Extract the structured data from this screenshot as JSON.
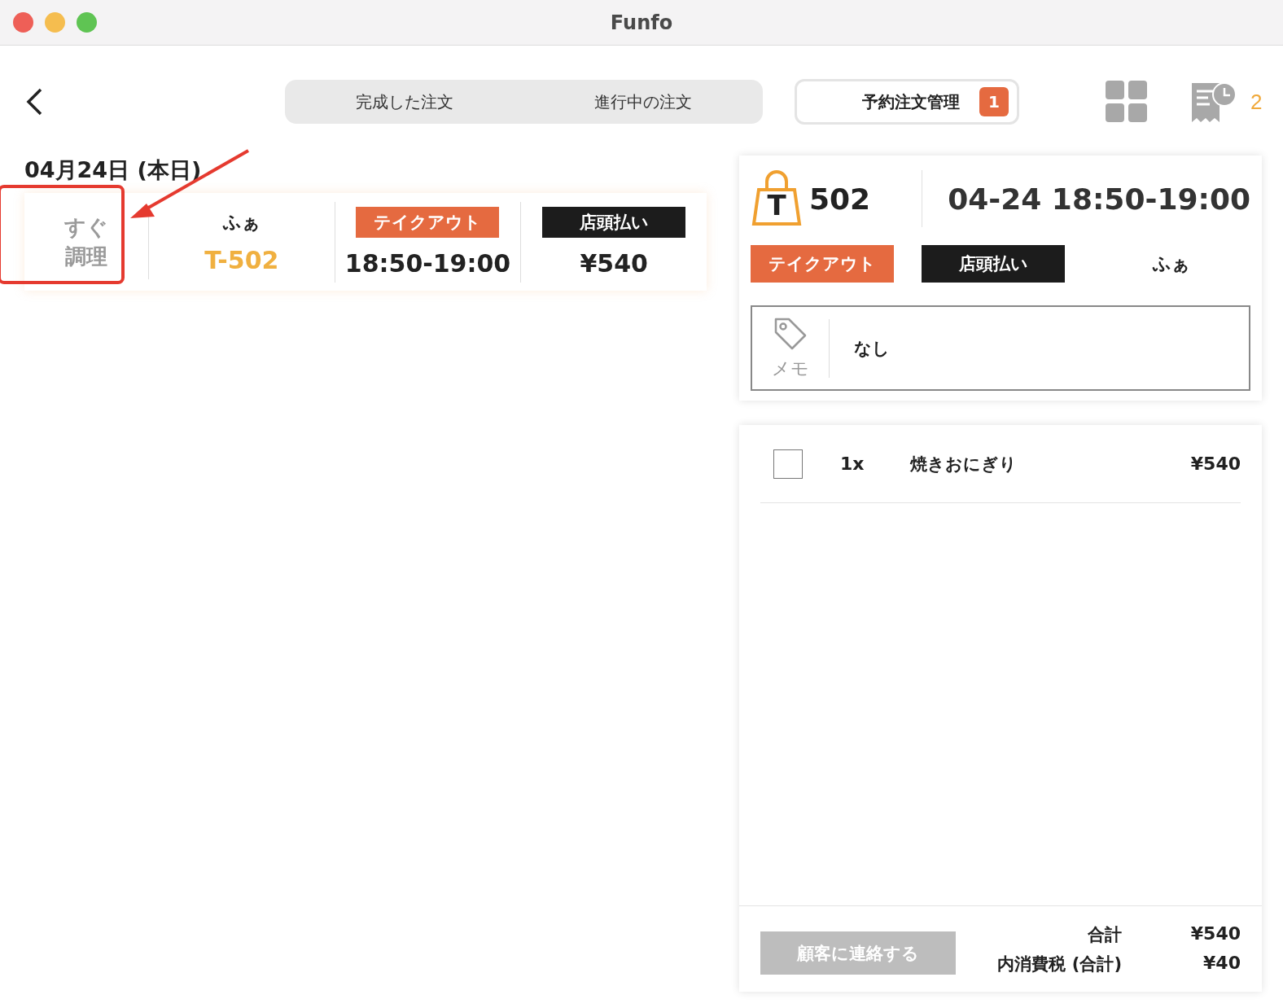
{
  "window": {
    "title": "Funfo"
  },
  "tabs": [
    {
      "label": "完成した注文",
      "selected": false
    },
    {
      "label": "進行中の注文",
      "selected": false
    }
  ],
  "reservation_button": {
    "label": "予約注文管理",
    "badge": "1",
    "selected": true
  },
  "pending_receipts": {
    "count": "2"
  },
  "date_heading": "04月24日 (本日)",
  "orders": [
    {
      "status": "すぐ調理",
      "customer": "ふぁ",
      "code": "T-502",
      "order_type": "テイクアウト",
      "time": "18:50-19:00",
      "payment": "店頭払い",
      "total": "¥540"
    }
  ],
  "detail": {
    "bag_letter": "T",
    "number": "502",
    "datetime": "04-24 18:50-19:00",
    "order_type": "テイクアウト",
    "payment": "店頭払い",
    "customer": "ふぁ",
    "memo_label": "メモ",
    "memo": "なし",
    "items": [
      {
        "checked": false,
        "qty": "1x",
        "name": "焼きおにぎり",
        "price": "¥540"
      }
    ],
    "contact_button": {
      "label": "顧客に連絡する",
      "disabled": true
    },
    "totals": [
      {
        "label": "合計",
        "value": "¥540"
      },
      {
        "label": "内消費税 (合計)",
        "value": "¥40"
      }
    ]
  }
}
